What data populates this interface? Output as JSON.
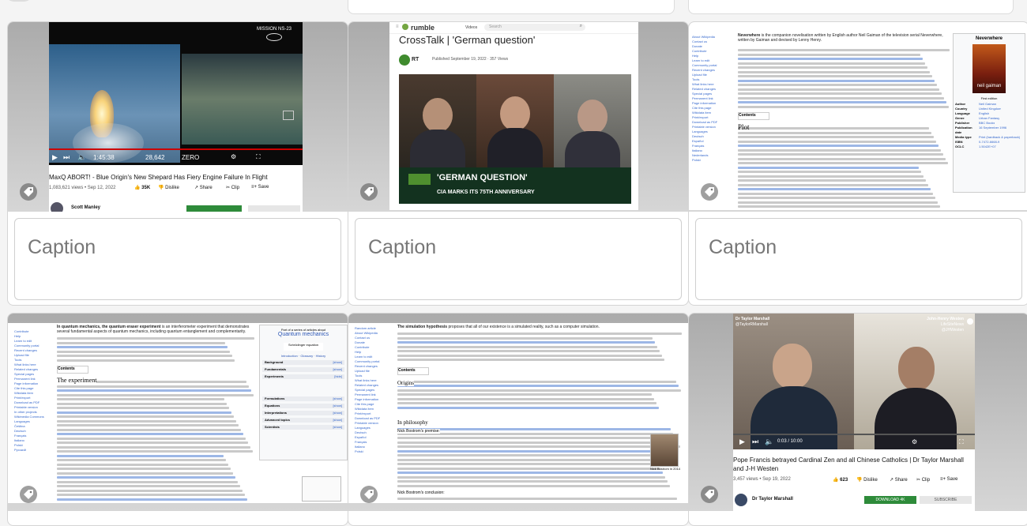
{
  "captions": {
    "c1": "Caption",
    "c2": "Caption",
    "c3": "Caption"
  },
  "video1": {
    "mission": "MISSION NS-23",
    "title": "MaxQ ABORT! - Blue Origin's New Shepard Has Fiery Engine Failure In Flight",
    "meta": "1,083,621 views • Sep 12, 2022",
    "likes": "35K",
    "dislike": "Dislike",
    "share": "Share",
    "clip": "Clip",
    "save": "Save",
    "channel": "Scott Manley",
    "time": "1:45:38",
    "speed": "28,642",
    "alt": "ZERO"
  },
  "rumble": {
    "logo": "rumble",
    "nav": "Videos",
    "search_placeholder": "Search",
    "title": "CrossTalk | 'German question'",
    "channel": "RT",
    "published": "Published September 19, 2022 · 357 Views",
    "overlay": "'GERMAN QUESTION'",
    "ticker": "CIA MARKS ITS 75TH ANNIVERSARY"
  },
  "neverwhere": {
    "lead_term": "Neverwhere",
    "lead": "is the companion novelisation written by English author Neil Gaiman of the television serial Neverwhere, written by Gaiman and devised by Lenny Henry.",
    "infobox_title": "Neverwhere",
    "cover_author": "neil gaiman",
    "first_edition": "First edition",
    "contents": "Contents",
    "plot": "Plot",
    "infobox": [
      [
        "Author",
        "Neil Gaiman"
      ],
      [
        "Country",
        "United Kingdom"
      ],
      [
        "Language",
        "English"
      ],
      [
        "Genre",
        "Urban Fantasy"
      ],
      [
        "Publisher",
        "BBC Books"
      ],
      [
        "Publication date",
        "16 September 1996"
      ],
      [
        "Media type",
        "Print (hardback & paperback)"
      ],
      [
        "ISBN",
        "0-7472-6668-9"
      ],
      [
        "OCLC",
        "1.5042E+07"
      ]
    ],
    "side": [
      "About Wikipedia",
      "Contact us",
      "Donate",
      "Contribute",
      "Help",
      "Learn to edit",
      "Community portal",
      "Recent changes",
      "Upload file",
      "Tools",
      "What links here",
      "Related changes",
      "Special pages",
      "Permanent link",
      "Page information",
      "Cite this page",
      "Wikidata item",
      "Print/export",
      "Download as PDF",
      "Printable version",
      "Languages",
      "Deutsch",
      "Español",
      "Français",
      "Italiano",
      "Nederlands",
      "Polski"
    ]
  },
  "quantum": {
    "lead_term": "In quantum mechanics, the quantum eraser experiment",
    "lead": "is an interferometer experiment that demonstrates several fundamental aspects of quantum mechanics, including quantum entanglement and complementarity.",
    "heading": "The experiment",
    "contents": "Contents",
    "navbox_series": "Part of a series of articles about",
    "navbox_title": "Quantum mechanics",
    "navbox_eq": "Schrödinger equation",
    "navbox_links": "Introduction · Glossary · History",
    "navbox_rows": [
      "Background",
      "Fundamentals",
      "Experiments",
      "Formulations",
      "Equations",
      "Interpretations",
      "Advanced topics",
      "Scientists"
    ],
    "show": "[show]",
    "hide": "[hide]",
    "side": [
      "Contribute",
      "Help",
      "Learn to edit",
      "Community portal",
      "Recent changes",
      "Upload file",
      "Tools",
      "What links here",
      "Related changes",
      "Special pages",
      "Permanent link",
      "Page information",
      "Cite this page",
      "Wikidata item",
      "Print/export",
      "Download as PDF",
      "Printable version",
      "In other projects",
      "Wikimedia Commons",
      "Languages",
      "Čeština",
      "Deutsch",
      "Français",
      "Italiano",
      "Polski",
      "Русский"
    ]
  },
  "simulation": {
    "lead_term": "The simulation hypothesis",
    "lead": "proposes that all of our existence is a simulated reality, such as a computer simulation.",
    "origins": "Origins",
    "philosophy": "In philosophy",
    "premise": "Nick Bostrom's premise:",
    "conclusion": "Nick Bostrom's conclusion:",
    "contents": "Contents",
    "photo_caption": "Nick Bostrom in 2014",
    "side": [
      "Random article",
      "About Wikipedia",
      "Contact us",
      "Donate",
      "Contribute",
      "Help",
      "Learn to edit",
      "Community portal",
      "Recent changes",
      "Upload file",
      "Tools",
      "What links here",
      "Related changes",
      "Special pages",
      "Permanent link",
      "Page information",
      "Cite this page",
      "Wikidata item",
      "Print/export",
      "Download as PDF",
      "Printable version",
      "Languages",
      "Deutsch",
      "Español",
      "Français",
      "Italiano",
      "Polski"
    ]
  },
  "video2": {
    "left_name": "Dr Taylor Marshall",
    "left_handle": "@TaylorRMarshall",
    "right_name": "John-Henry Westen",
    "right_org": "LifeSiteNews",
    "right_handle": "@JHWesten",
    "time": "0:03 / 10:00",
    "title": "Pope Francis betrayed Cardinal Zen and all Chinese Catholics | Dr Taylor Marshall and J-H Westen",
    "meta": "3,457 views • Sep 19, 2022",
    "likes": "623",
    "dislike": "Dislike",
    "share": "Share",
    "clip": "Clip",
    "save": "Save",
    "channel": "Dr Taylor Marshall",
    "download": "DOWNLOAD 4K",
    "subscribe": "SUBSCRIBE"
  }
}
